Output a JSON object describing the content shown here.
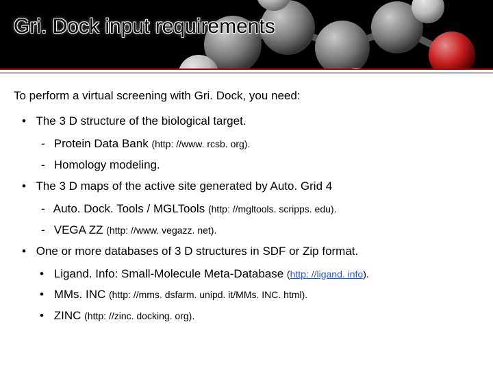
{
  "title": "Gri. Dock input requirements",
  "intro": "To perform a virtual screening with Gri. Dock, you need:",
  "items": [
    {
      "text": "The 3 D structure of the biological target.",
      "children": [
        {
          "text": "Protein Data Bank",
          "sub": "(http: //www. rcsb. org).",
          "dash": true
        },
        {
          "text": "Homology modeling.",
          "dash": true
        }
      ]
    },
    {
      "text": "The 3 D maps of the active site generated by Auto. Grid 4",
      "children": [
        {
          "text": "Auto. Dock. Tools / MGLTools",
          "sub": "(http: //mgltools. scripps. edu).",
          "dash": true
        },
        {
          "text": "VEGA ZZ",
          "sub": "(http: //www. vegazz. net).",
          "dash": true
        }
      ]
    },
    {
      "text": "One or more databases of 3 D structures in SDF or Zip format.",
      "children": [
        {
          "text": "Ligand. Info: Small-Molecule Meta-Database",
          "sub_pre": "(",
          "sub_link": "http: //ligand. info",
          "sub_post": ").",
          "dash": false
        },
        {
          "text": "MMs. INC",
          "sub": "(http: //mms. dsfarm. unipd. it/MMs. INC. html).",
          "dash": false
        },
        {
          "text": "ZINC",
          "sub": "(http: //zinc. docking. org).",
          "dash": false
        }
      ]
    }
  ]
}
